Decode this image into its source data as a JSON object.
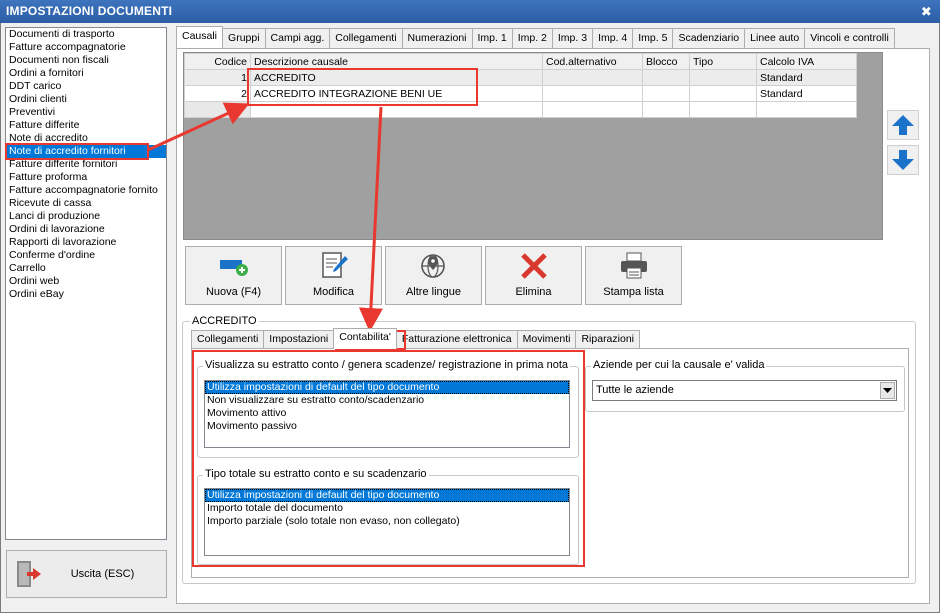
{
  "window": {
    "title": "IMPOSTAZIONI DOCUMENTI",
    "close_glyph": "✖"
  },
  "doc_types": [
    "Documenti di trasporto",
    "Fatture accompagnatorie",
    "Documenti non fiscali",
    "Ordini a fornitori",
    "DDT carico",
    "Ordini clienti",
    "Preventivi",
    "Fatture differite",
    "Note di accredito",
    "Note di accredito fornitori",
    "Fatture differite fornitori",
    "Fatture proforma",
    "Fatture accompagnatorie fornito",
    "Ricevute di cassa",
    "Lanci di produzione",
    "Ordini di lavorazione",
    "Rapporti di lavorazione",
    "Conferme d'ordine",
    "Carrello",
    "Ordini web",
    "Ordini eBay"
  ],
  "doc_types_selected": "Note di accredito fornitori",
  "main_tabs": [
    "Causali",
    "Gruppi",
    "Campi agg.",
    "Collegamenti",
    "Numerazioni",
    "Imp. 1",
    "Imp. 2",
    "Imp. 3",
    "Imp. 4",
    "Imp. 5",
    "Scadenziario",
    "Linee auto",
    "Vincoli e controlli"
  ],
  "main_tab_active": "Causali",
  "grid": {
    "columns": [
      "Codice",
      "Descrizione causale",
      "Cod.alternativo",
      "Blocco",
      "Tipo",
      "Calcolo IVA"
    ],
    "rows": [
      {
        "codice": "1",
        "descrizione": "ACCREDITO",
        "cod_alt": "",
        "blocco": "",
        "tipo": "",
        "calcolo_iva": "Standard"
      },
      {
        "codice": "2",
        "descrizione": "ACCREDITO INTEGRAZIONE BENI UE",
        "cod_alt": "",
        "blocco": "",
        "tipo": "",
        "calcolo_iva": "Standard"
      }
    ]
  },
  "toolbar": {
    "new": "Nuova (F4)",
    "edit": "Modifica",
    "languages": "Altre lingue",
    "delete": "Elimina",
    "print": "Stampa lista"
  },
  "exit_button": "Uscita (ESC)",
  "causale_group": {
    "title": "ACCREDITO",
    "tabs": [
      "Collegamenti",
      "Impostazioni",
      "Contabilita'",
      "Fatturazione elettronica",
      "Movimenti",
      "Riparazioni"
    ],
    "active_tab": "Contabilita'"
  },
  "contabilita": {
    "visualizza": {
      "legend": "Visualizza su estratto conto / genera scadenze/ registrazione  in prima nota",
      "options": [
        "Utilizza impostazioni di default del tipo documento",
        "Non visualizzare su estratto conto/scadenzario",
        "Movimento attivo",
        "Movimento passivo"
      ],
      "selected": "Utilizza impostazioni di default del tipo documento"
    },
    "tipo_totale": {
      "legend": "Tipo totale su estratto conto e su scadenzario",
      "options": [
        "Utilizza impostazioni di default del tipo documento",
        "Importo totale del documento",
        "Importo parziale (solo totale non evaso, non collegato)"
      ],
      "selected": "Utilizza impostazioni di default del tipo documento"
    },
    "aziende": {
      "legend": "Aziende per cui la causale e' valida",
      "value": "Tutte le aziende"
    }
  },
  "colors": {
    "titlebar": "#2b5ea7",
    "selection": "#0078d7",
    "highlight": "#e8382f",
    "arrow_blue": "#1a73c9"
  }
}
